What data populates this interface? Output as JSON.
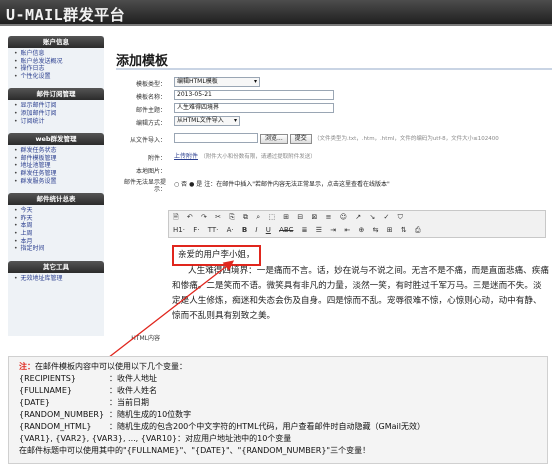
{
  "app": {
    "title": "U-MAIL群发平台"
  },
  "sidebar": {
    "sections": [
      {
        "title": "账户信息",
        "items": [
          "账户信息",
          "账户总发送概况",
          "操作日志",
          "个性化设置"
        ]
      },
      {
        "title": "邮件订阅管理",
        "items": [
          "显示邮件订阅",
          "添加邮件订阅",
          "订阅统计"
        ]
      },
      {
        "title": "web群发管理",
        "items": [
          "群发任务状态",
          "邮件模板管理",
          "地址池管理",
          "群发任务管理",
          "群发服务设置"
        ]
      },
      {
        "title": "邮件统计总表",
        "items": [
          "今天",
          "昨天",
          "本周",
          "上周",
          "本月",
          "指定时间"
        ]
      },
      {
        "title": "其它工具",
        "items": [
          "无效地址库管理"
        ]
      }
    ]
  },
  "main": {
    "title": "添加模板",
    "form": {
      "type_label": "模板类型：",
      "type_value": "编辑HTML模板",
      "name_label": "模板名称：",
      "name_value": "2013-05-21",
      "subject_label": "邮件主题：",
      "subject_value": "人生难得四境界",
      "encoding_label": "编辑方式：",
      "encoding_value": "从HTML文件导入",
      "import_label": "从文件导入：",
      "browse_label": "浏览...",
      "submit_label": "提交",
      "import_hint": "（文件类型为.txt，.htm，.html，文件的编码为utf-8，文件大小≤102400",
      "attach_label": "附件：",
      "attach_link": "上传附件",
      "attach_hint": "（附件大小和份数有限，请通过提取附件发送）",
      "local_label": "本地图片：",
      "fallback_label": "邮件无法显示提示：",
      "fallback_no": "否",
      "fallback_yes": "是",
      "fallback_hint": "注：在邮件中插入\"若邮件内容无法正常显示，点击这里查看在线版本\"",
      "html_label": "HTML内容"
    },
    "toolbar": {
      "row1": [
        "🗎",
        "↶",
        "↷",
        "✂",
        "⎘",
        "⧉",
        "⌕",
        "⬚",
        "⊞",
        "⊟",
        "⊠",
        "≡",
        "☺",
        "↗",
        "↘",
        "✓",
        "⛉"
      ],
      "row2": [
        "H1·",
        "F·",
        "TT·",
        "A·",
        "B",
        "I",
        "U",
        "ABC",
        "≣",
        "☰",
        "⇥",
        "⇤",
        "⊕",
        "⇆",
        "⊞",
        "⇅",
        "⎙"
      ]
    },
    "editor": {
      "greeting": "亲爱的用户李小姐，",
      "body": "人生难得四境界：一是痛而不言。话，妙在说与不说之间。无言不是不痛，而是直面悲痛、疾痛和惨痛。二是笑而不语。微笑具有非凡的力量，淡然一笑，有时胜过千军万马。三是迷而不失。淡定是人生修炼，痴迷和失态会伤及自身。四是惊而不乱。宠辱很难不惊，心惊则心动，动中有静、惊而不乱则具有别致之美。"
    }
  },
  "note": {
    "prefix": "注：",
    "intro": "在邮件模板内容中可以使用以下几个变量：",
    "vars": [
      {
        "name": "{RECIPIENTS}",
        "desc": "：收件人地址"
      },
      {
        "name": "{FULLNAME}",
        "desc": "：收件人姓名"
      },
      {
        "name": "{DATE}",
        "desc": "：当前日期"
      },
      {
        "name": "{RANDOM_NUMBER}",
        "desc": "：随机生成的10位数字"
      },
      {
        "name": "{RANDOM_HTML}",
        "desc": "：随机生成的包含200个中文字符的HTML代码，用户查看邮件时自动隐藏（GMail无效）"
      }
    ],
    "var_list_line": "{VAR1}, {VAR2}, {VAR3}, ..., {VAR10}：对应用户地址池中的10个变量",
    "subject_line": "在邮件标题中可以使用其中的\"{FULLNAME}\"、\"{DATE}\"、\"{RANDOM_NUMBER}\"三个变量！"
  },
  "colors": {
    "accent_red": "#e0261d",
    "header_bg": "#2b2b2b",
    "link": "#2a3e8f"
  }
}
